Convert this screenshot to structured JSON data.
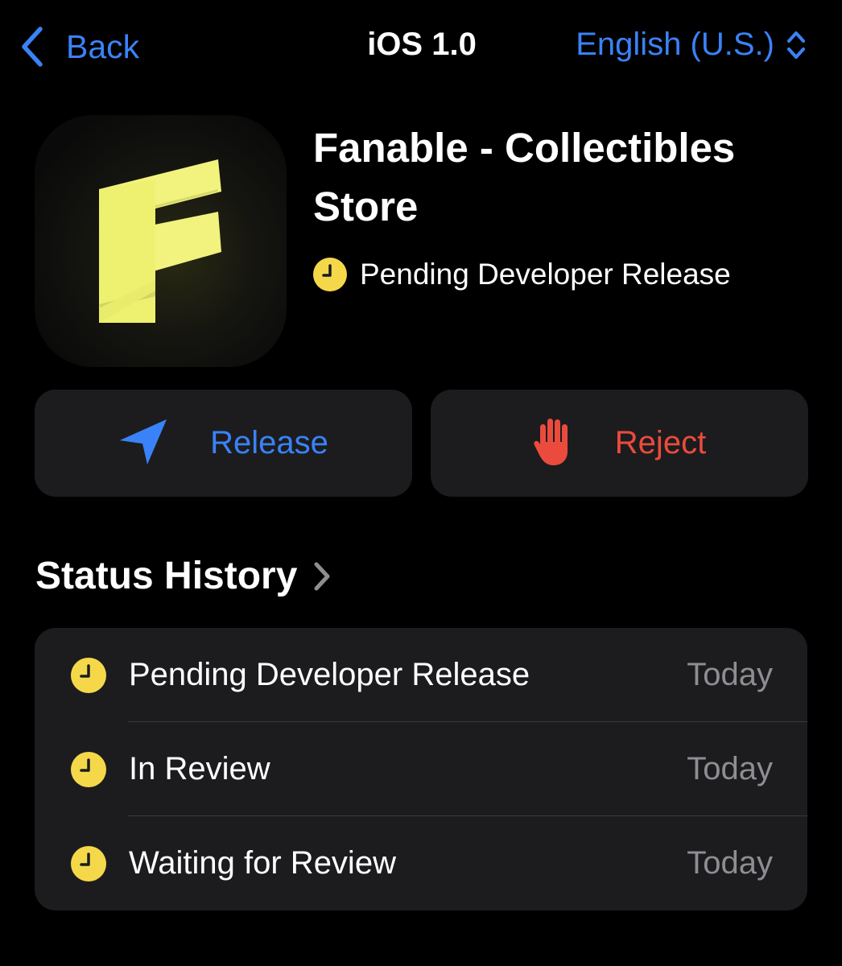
{
  "nav": {
    "back_label": "Back",
    "title": "iOS 1.0",
    "locale_label": "English (U.S.)"
  },
  "app": {
    "name_line1": "Fanable - Collectibles",
    "name_line2": "Store",
    "status": "Pending Developer Release",
    "icon": "fanable-app-icon"
  },
  "actions": {
    "release_label": "Release",
    "reject_label": "Reject"
  },
  "status_history": {
    "title": "Status History",
    "rows": [
      {
        "label": "Pending Developer Release",
        "date": "Today"
      },
      {
        "label": "In Review",
        "date": "Today"
      },
      {
        "label": "Waiting for Review",
        "date": "Today"
      }
    ]
  },
  "colors": {
    "background": "#000000",
    "card": "#1c1c1e",
    "accent_blue": "#3a82f7",
    "reject_red": "#eb4b3d",
    "pending_yellow": "#f5d84a",
    "secondary_text": "#8d8d92",
    "app_icon_yellow": "#f1f37e"
  }
}
